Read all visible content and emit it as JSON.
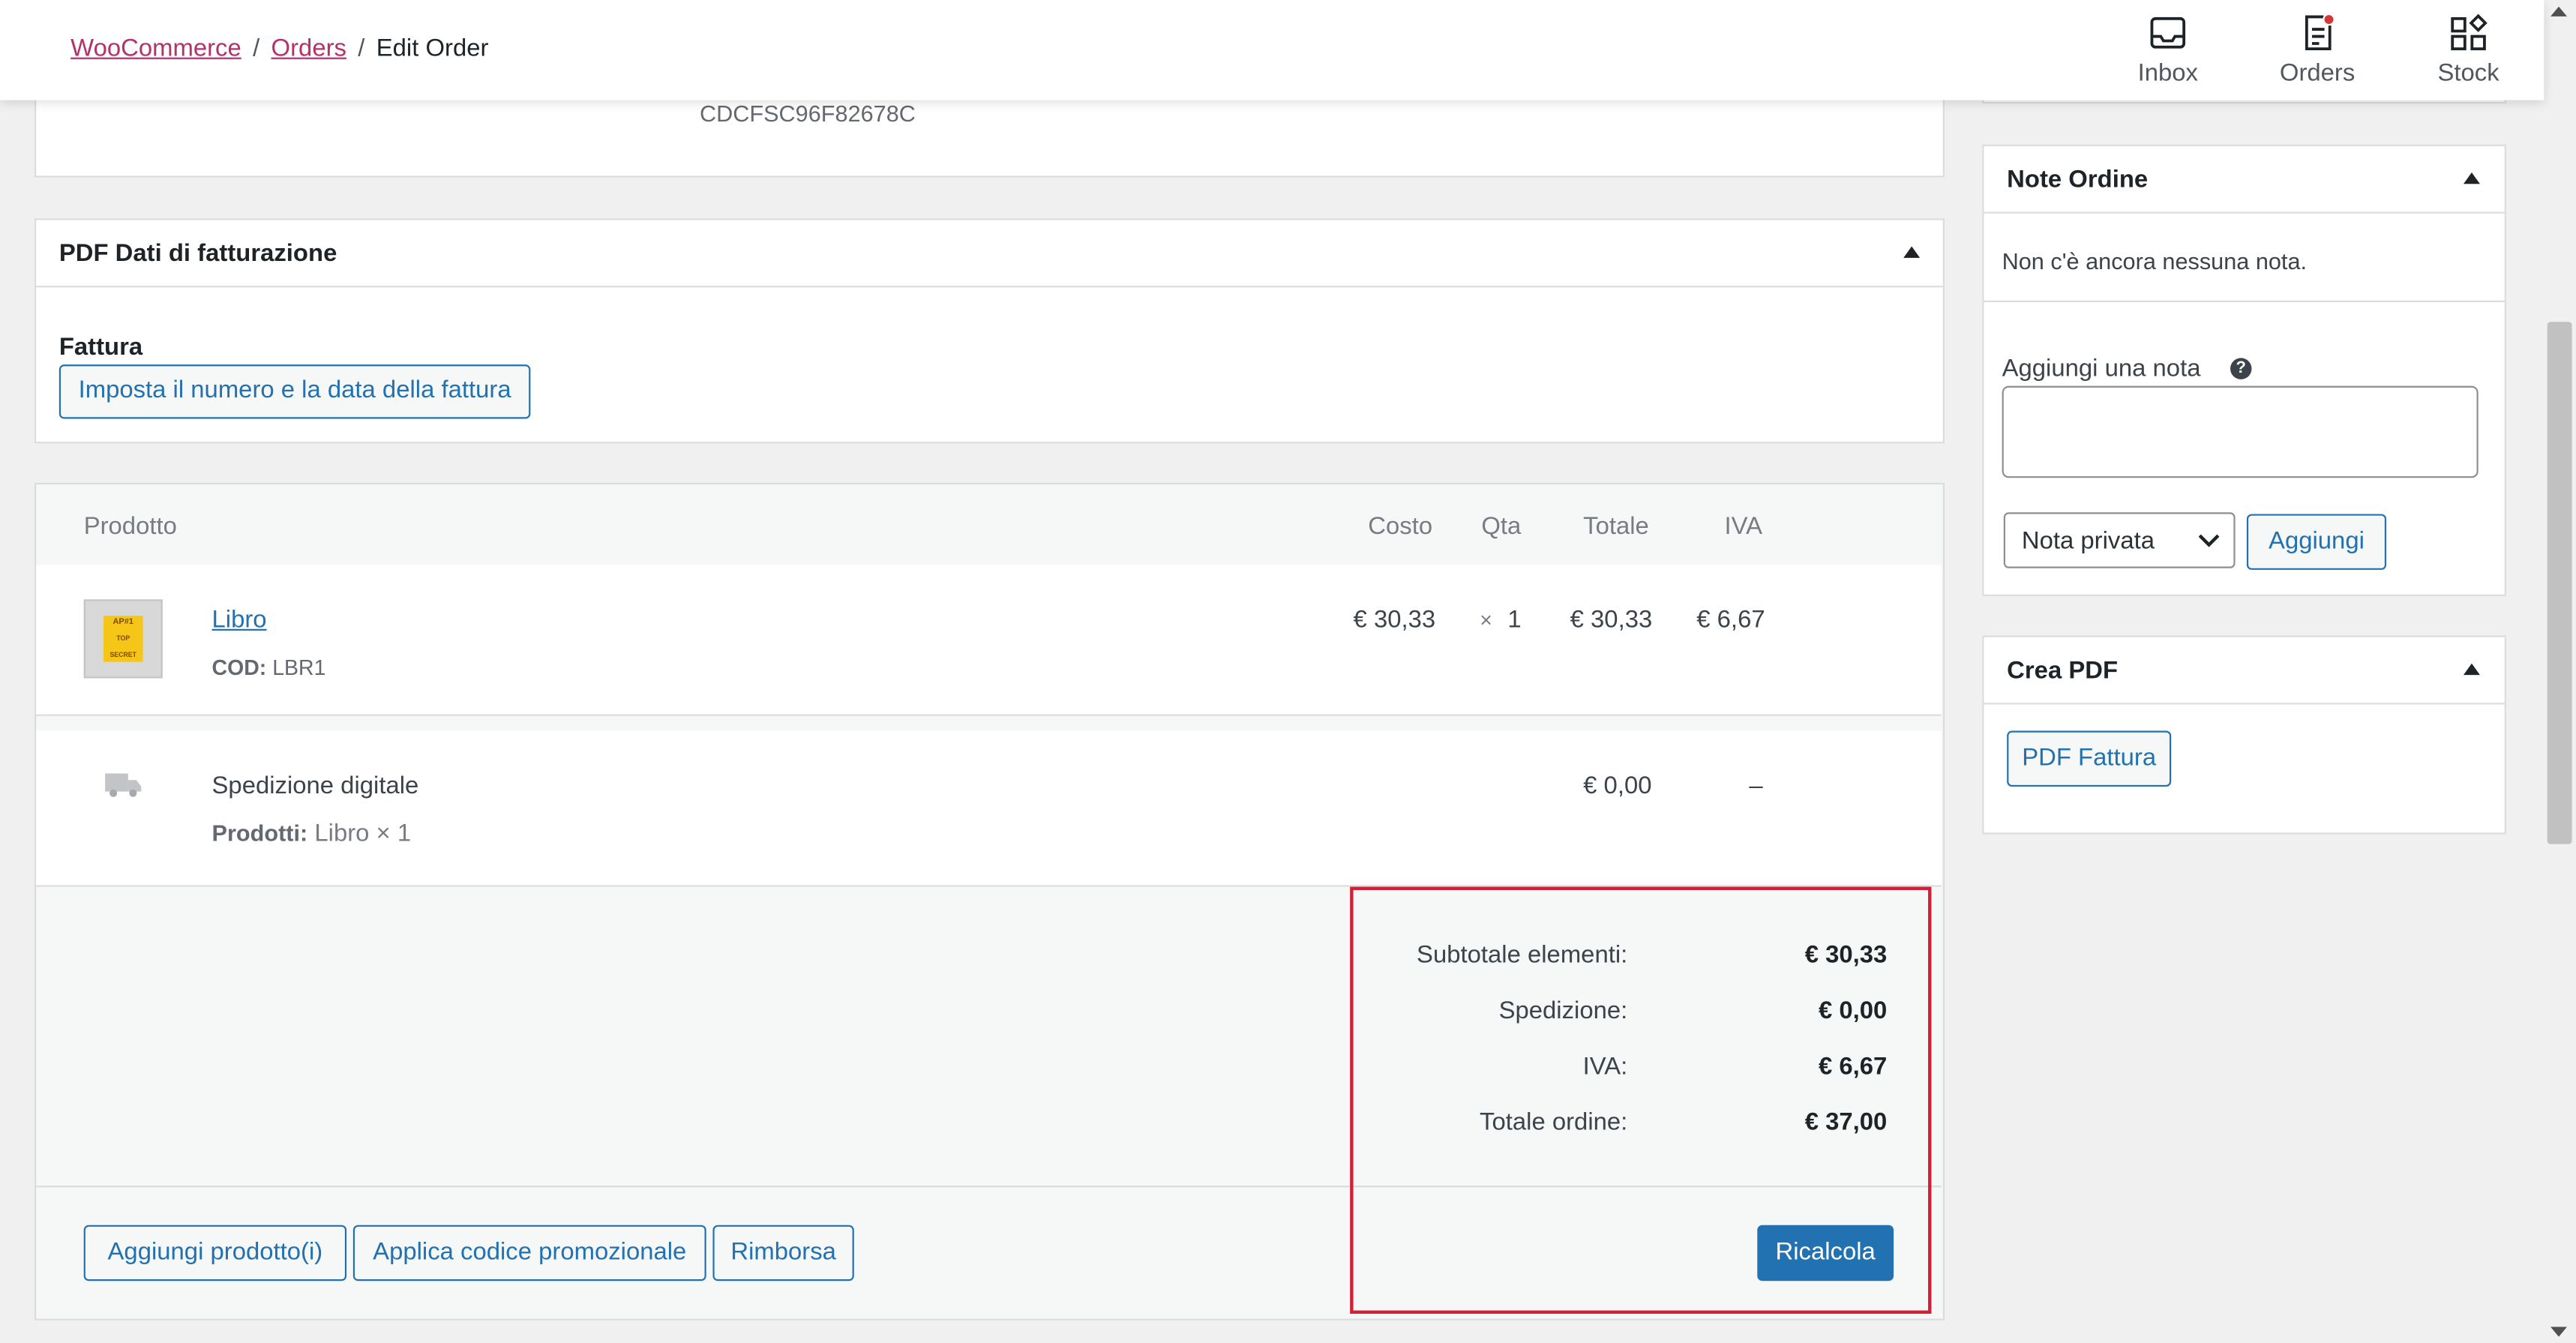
{
  "breadcrumb": {
    "root": "WooCommerce",
    "orders": "Orders",
    "current": "Edit Order"
  },
  "topbar": {
    "inbox": "Inbox",
    "orders": "Orders",
    "stock": "Stock"
  },
  "top_panel": {
    "code": "CDCFSC96F82678C"
  },
  "pdf_billing": {
    "title": "PDF Dati di fatturazione",
    "invoice_label": "Fattura",
    "set_invoice_button": "Imposta il numero e la data della fattura"
  },
  "items_table": {
    "headers": {
      "product": "Prodotto",
      "cost": "Costo",
      "qty": "Qta",
      "total": "Totale",
      "vat": "IVA"
    },
    "product": {
      "name": "Libro",
      "sku_label": "COD:",
      "sku": "LBR1",
      "cost": "€ 30,33",
      "qty_x": "×",
      "qty": "1",
      "total": "€ 30,33",
      "vat": "€ 6,67",
      "thumb_text_1": "AP#1",
      "thumb_text_2": "TOP SECRET"
    },
    "shipping": {
      "name": "Spedizione digitale",
      "products_label": "Prodotti:",
      "products": "Libro × 1",
      "total": "€ 0,00",
      "vat": "–"
    }
  },
  "totals": {
    "subtotal_label": "Subtotale elementi:",
    "subtotal": "€ 30,33",
    "shipping_label": "Spedizione:",
    "shipping": "€ 0,00",
    "vat_label": "IVA:",
    "vat": "€ 6,67",
    "order_total_label": "Totale ordine:",
    "order_total": "€ 37,00"
  },
  "actions": {
    "add_products": "Aggiungi prodotto(i)",
    "apply_coupon": "Applica codice promozionale",
    "refund": "Rimborsa",
    "recalculate": "Ricalcola"
  },
  "order_notes": {
    "title": "Note Ordine",
    "empty": "Non c'è ancora nessuna nota.",
    "add_label": "Aggiungi una nota",
    "note_text": "",
    "note_type": "Nota privata",
    "add_button": "Aggiungi"
  },
  "create_pdf": {
    "title": "Crea PDF",
    "invoice_button": "PDF Fattura"
  },
  "colors": {
    "accent": "#2271b1",
    "link": "#b3326b",
    "highlight": "#d32035",
    "badge": "#d63638"
  }
}
